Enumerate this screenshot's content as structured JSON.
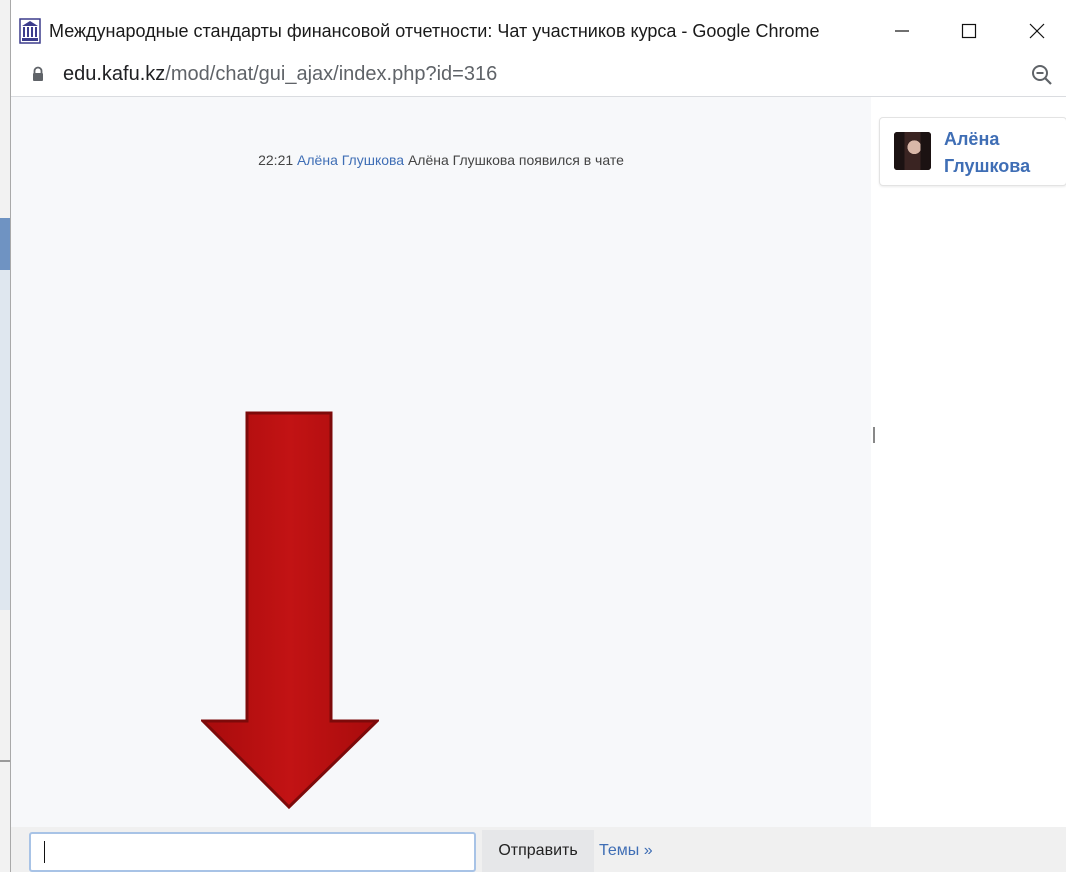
{
  "browser": {
    "window_title": "Международные стандарты финансовой отчетности: Чат участников курса - Google Chrome",
    "url_host": "edu.kafu.kz",
    "url_path": "/mod/chat/gui_ajax/index.php?id=316"
  },
  "chat": {
    "messages": [
      {
        "time": "22:21",
        "user": "Алёна Глушкова",
        "text": "Алёна Глушкова появился в чате"
      }
    ],
    "input": {
      "value": "",
      "placeholder": ""
    },
    "send_label": "Отправить",
    "topics_label": "Темы »"
  },
  "users": [
    {
      "name": "Алёна Глушкова"
    }
  ],
  "icons": {
    "app": "kafu-logo-icon",
    "lock": "lock-icon",
    "zoom": "zoom-out-icon",
    "minimize": "minimize-icon",
    "maximize": "maximize-icon",
    "close": "close-icon"
  },
  "colors": {
    "link": "#3f6eb5",
    "arrow": "#b50f10",
    "chat_bg": "#f7f8fa",
    "input_border": "#a8c3e6"
  }
}
